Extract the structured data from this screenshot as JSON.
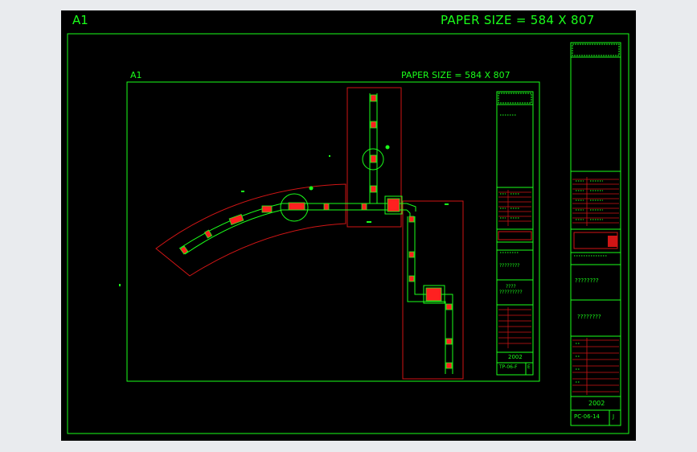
{
  "viewport": {
    "outer_sheet_label": "A1",
    "outer_paper_size": "PAPER SIZE = 584 X 807",
    "inner_sheet_label": "A1",
    "inner_paper_size": "PAPER SIZE = 584 X 807"
  },
  "title_block_small": {
    "questions_a": "????????",
    "questions_b": "????",
    "questions_c": "?????????",
    "year": "2002",
    "drawing_no": "TP-06-F",
    "rev": "E"
  },
  "title_block_large": {
    "questions_a": "????????",
    "questions_b": "????????",
    "year": "2002",
    "drawing_no": "PC-06-14",
    "rev": "J"
  },
  "colors": {
    "background": "#000000",
    "line": "#1aff1a",
    "highlight": "#ff2020",
    "boundary": "#d01515",
    "frame": "#e9ebee"
  }
}
